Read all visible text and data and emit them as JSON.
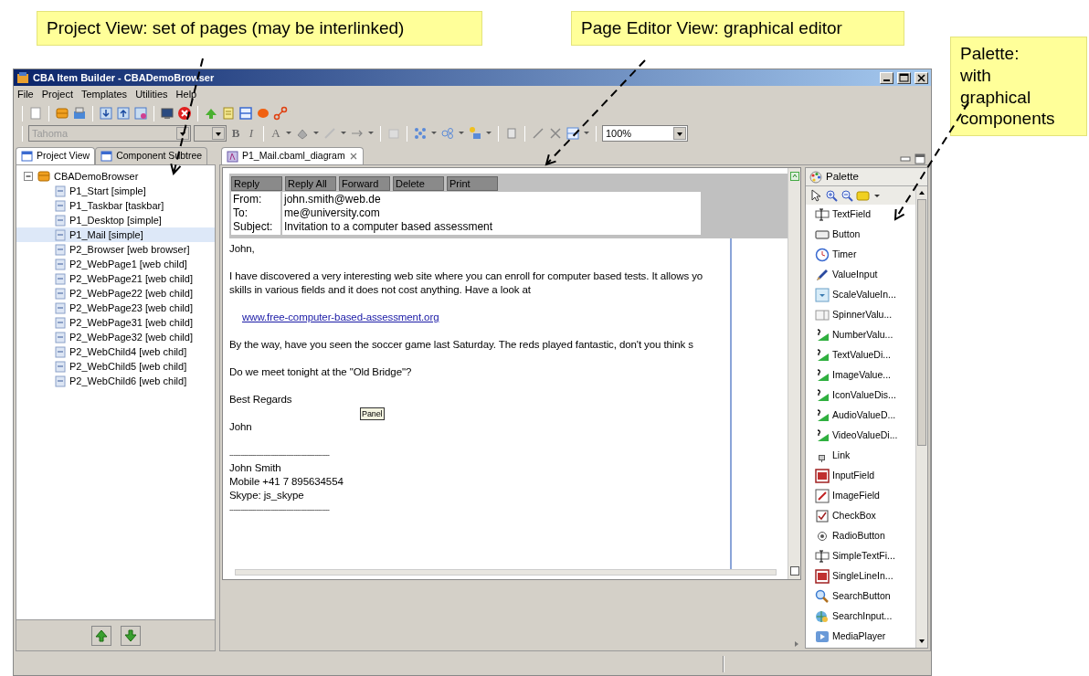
{
  "callouts": [
    {
      "text": "Project View: set of pages (may be interlinked)"
    },
    {
      "text": "Page Editor View: graphical editor"
    },
    {
      "text": "Palette:\nwith\ngraphical\ncomponents"
    }
  ],
  "window": {
    "title": "CBA Item Builder - CBADemoBrowser",
    "menu": [
      "File",
      "Project",
      "Templates",
      "Utilities",
      "Help"
    ]
  },
  "toolbar": {
    "font_combo": "Tahoma",
    "format_glyphs": [
      "B",
      "I",
      "A"
    ],
    "zoom_combo": "100%"
  },
  "project_view": {
    "tabs": [
      {
        "label": "Project View",
        "selected": true
      },
      {
        "label": "Component Subtree",
        "selected": false
      }
    ],
    "tree": [
      {
        "label": "CBADemoBrowser",
        "expanded": true,
        "selected": false,
        "children": [
          {
            "label": "P1_Start [simple]",
            "selected": false
          },
          {
            "label": "P1_Taskbar [taskbar]",
            "selected": false
          },
          {
            "label": "P1_Desktop [simple]",
            "selected": false
          },
          {
            "label": "P1_Mail [simple]",
            "selected": true
          },
          {
            "label": "P2_Browser [web browser]",
            "selected": false
          },
          {
            "label": "P2_WebPage1 [web child]",
            "selected": false
          },
          {
            "label": "P2_WebPage21 [web child]",
            "selected": false
          },
          {
            "label": "P2_WebPage22 [web child]",
            "selected": false
          },
          {
            "label": "P2_WebPage23 [web child]",
            "selected": false
          },
          {
            "label": "P2_WebPage31 [web child]",
            "selected": false
          },
          {
            "label": "P2_WebPage32 [web child]",
            "selected": false
          },
          {
            "label": "P2_WebChild4 [web child]",
            "selected": false
          },
          {
            "label": "P2_WebChild5 [web child]",
            "selected": false
          },
          {
            "label": "P2_WebChild6 [web child]",
            "selected": false
          }
        ]
      }
    ]
  },
  "editor": {
    "tab": "P1_Mail.cbaml_diagram",
    "mail": {
      "buttons": [
        "Reply",
        "Reply All",
        "Forward",
        "Delete",
        "Print"
      ],
      "header": [
        {
          "label": "From:",
          "value": "john.smith@web.de"
        },
        {
          "label": "To:",
          "value": "me@university.com"
        },
        {
          "label": "Subject:",
          "value": "Invitation to a computer based assessment"
        }
      ],
      "body": [
        {
          "kind": "text",
          "text": "John,"
        },
        {
          "kind": "blank"
        },
        {
          "kind": "text",
          "text": "I have discovered a very interesting web site where you can enroll for computer based tests. It allows yo"
        },
        {
          "kind": "text",
          "text": "skills in various fields and it does not cost anything. Have a look at"
        },
        {
          "kind": "blank"
        },
        {
          "kind": "link",
          "text": "www.free-computer-based-assessment.org"
        },
        {
          "kind": "blank"
        },
        {
          "kind": "text",
          "text": "By the way, have you seen the soccer game last Saturday. The reds played fantastic, don't you think s"
        },
        {
          "kind": "blank"
        },
        {
          "kind": "text",
          "text": "Do we meet tonight at the \"Old Bridge\"?"
        },
        {
          "kind": "blank"
        },
        {
          "kind": "text",
          "text": "Best Regards"
        },
        {
          "kind": "panel",
          "text": "Panel"
        },
        {
          "kind": "text",
          "text": "John"
        },
        {
          "kind": "blank"
        },
        {
          "kind": "rule",
          "text": "-----------------------------------------------------"
        },
        {
          "kind": "text",
          "text": "John Smith"
        },
        {
          "kind": "text",
          "text": "Mobile +41 7 895634554"
        },
        {
          "kind": "text",
          "text": "Skype: js_skype"
        },
        {
          "kind": "rule",
          "text": "-----------------------------------------------------"
        }
      ]
    }
  },
  "palette": {
    "title": "Palette",
    "items": [
      {
        "label": "TextField",
        "kind": "textfield"
      },
      {
        "label": "Button",
        "kind": "button"
      },
      {
        "label": "Timer",
        "kind": "timer"
      },
      {
        "label": "ValueInput",
        "kind": "pen"
      },
      {
        "label": "ScaleValueIn...",
        "kind": "scale"
      },
      {
        "label": "SpinnerValu...",
        "kind": "spinner"
      },
      {
        "label": "NumberValu...",
        "kind": "display"
      },
      {
        "label": "TextValueDi...",
        "kind": "display"
      },
      {
        "label": "ImageValue...",
        "kind": "display"
      },
      {
        "label": "IconValueDis...",
        "kind": "display"
      },
      {
        "label": "AudioValueD...",
        "kind": "display"
      },
      {
        "label": "VideoValueDi...",
        "kind": "display"
      },
      {
        "label": "Link",
        "kind": "link"
      },
      {
        "label": "InputField",
        "kind": "input"
      },
      {
        "label": "ImageField",
        "kind": "image"
      },
      {
        "label": "CheckBox",
        "kind": "checkbox"
      },
      {
        "label": "RadioButton",
        "kind": "radio"
      },
      {
        "label": "SimpleTextFi...",
        "kind": "textfield"
      },
      {
        "label": "SingleLineIn...",
        "kind": "input"
      },
      {
        "label": "SearchButton",
        "kind": "search"
      },
      {
        "label": "SearchInput...",
        "kind": "searchinput"
      },
      {
        "label": "MediaPlayer",
        "kind": "media"
      }
    ]
  }
}
